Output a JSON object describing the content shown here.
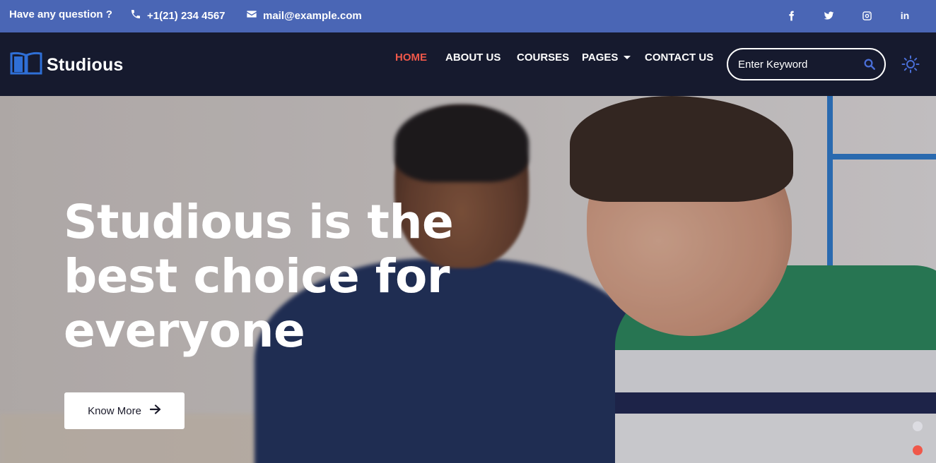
{
  "topbar": {
    "question": "Have any question ?",
    "phone": "+1(21) 234 4567",
    "email": "mail@example.com",
    "social": [
      "facebook-icon",
      "twitter-icon",
      "instagram-icon",
      "linkedin-icon"
    ],
    "linkedin_label": "in"
  },
  "nav": {
    "brand": "Studious",
    "menu": [
      {
        "label": "HOME",
        "active": true
      },
      {
        "label": "ABOUT US",
        "active": false
      },
      {
        "label": "COURSES",
        "active": false
      },
      {
        "label": "PAGES",
        "active": false,
        "dropdown": true
      },
      {
        "label": "CONTACT US",
        "active": false
      }
    ],
    "search_placeholder": "Enter Keyword"
  },
  "hero": {
    "title_lines": [
      "Studious is the",
      "best choice for",
      "everyone"
    ],
    "button_label": "Know More",
    "slide_count": 2,
    "active_slide": 2
  },
  "colors": {
    "topbar_bg": "#4a66b5",
    "nav_bg": "#161a2e",
    "accent": "#f0584a",
    "brand_blue": "#2f6fd6"
  }
}
